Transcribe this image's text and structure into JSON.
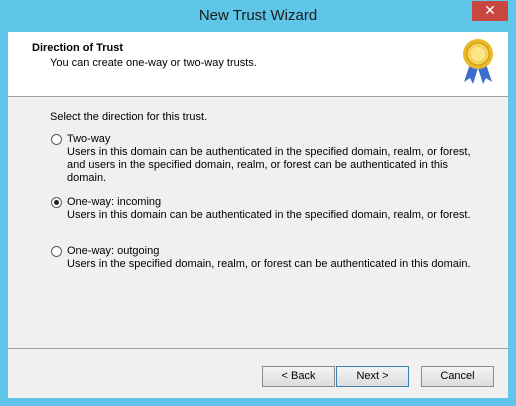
{
  "window": {
    "title": "New Trust Wizard",
    "close_glyph": "✕"
  },
  "header": {
    "title": "Direction of Trust",
    "subtitle": "You can create one-way or two-way trusts.",
    "icon": "certificate-seal-icon"
  },
  "prompt": "Select the direction for this trust.",
  "options": [
    {
      "label": "Two-way",
      "selected": false,
      "description": "Users in this domain can be authenticated in the specified domain, realm, or forest, and users in the specified domain, realm, or forest can be authenticated in this domain."
    },
    {
      "label": "One-way: incoming",
      "selected": true,
      "description": "Users in this domain can be authenticated in the specified domain, realm, or forest."
    },
    {
      "label": "One-way: outgoing",
      "selected": false,
      "description": "Users in the specified domain, realm, or forest can be authenticated in this domain."
    }
  ],
  "buttons": {
    "back": "< Back",
    "next": "Next >",
    "cancel": "Cancel"
  },
  "colors": {
    "titlebar": "#5fc6ea",
    "close": "#c7463d",
    "client": "#f0f0f0"
  }
}
